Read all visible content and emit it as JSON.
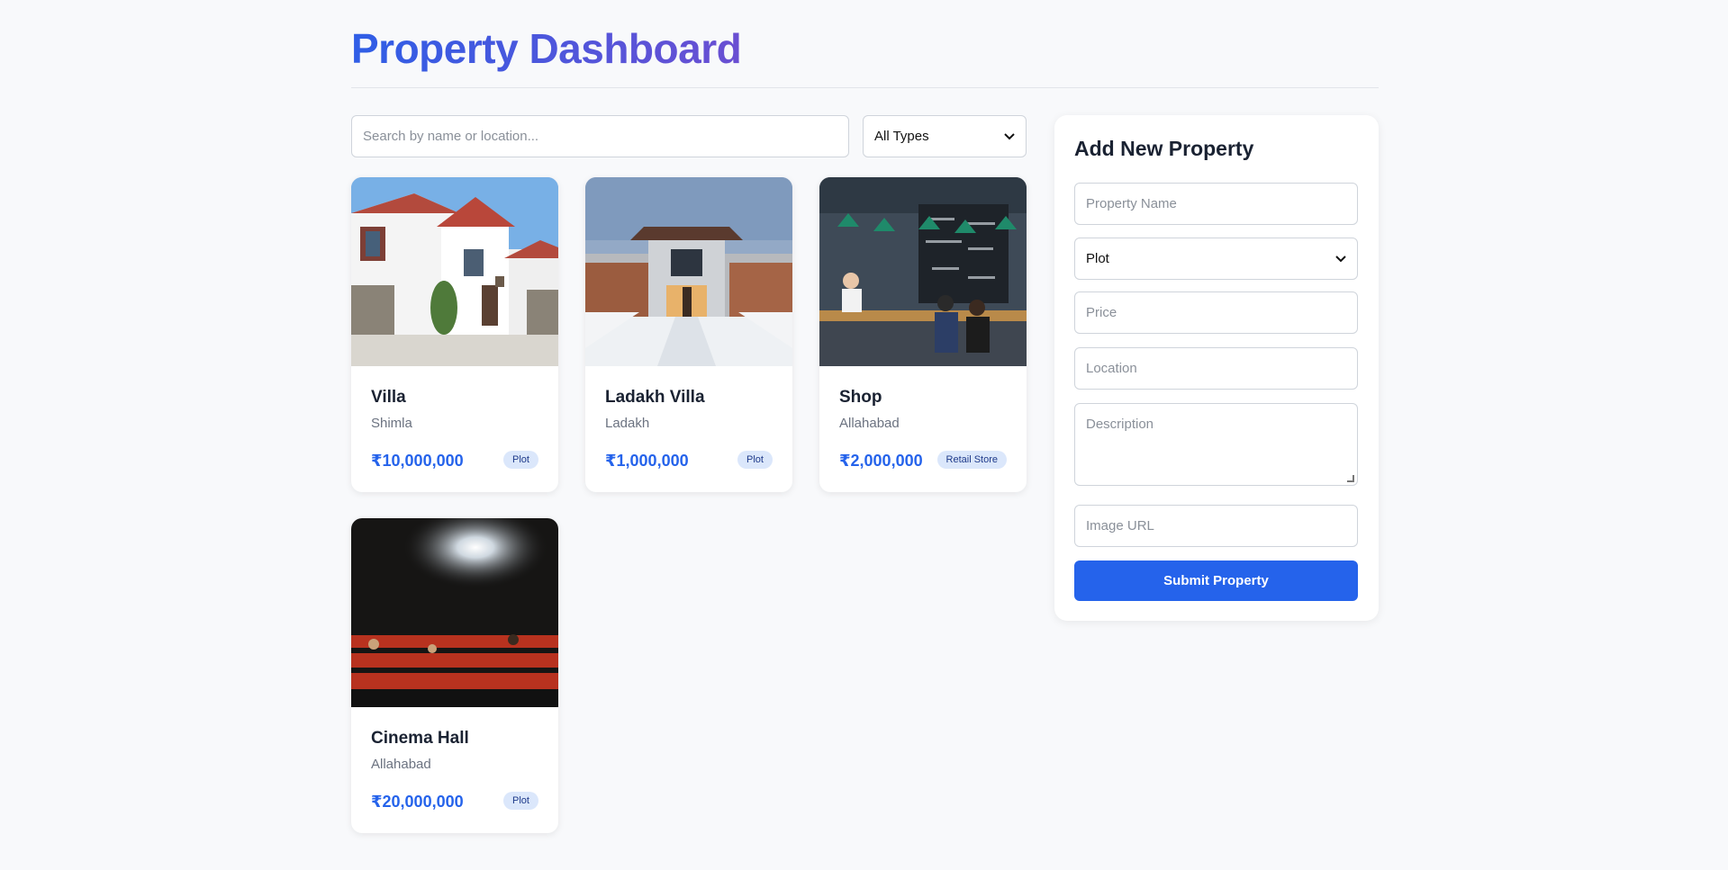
{
  "header": {
    "title": "Property Dashboard"
  },
  "filters": {
    "search_placeholder": "Search by name or location...",
    "type_selected": "All Types",
    "chevron_icon": "chevron-down-icon"
  },
  "properties": [
    {
      "name": "Villa",
      "location": "Shimla",
      "price": "₹10,000,000",
      "type": "Plot",
      "image": "white-villa-photo"
    },
    {
      "name": "Ladakh Villa",
      "location": "Ladakh",
      "price": "₹1,000,000",
      "type": "Plot",
      "image": "snow-house-photo"
    },
    {
      "name": "Shop",
      "location": "Allahabad",
      "price": "₹2,000,000",
      "type": "Retail Store",
      "image": "cafe-counter-photo"
    },
    {
      "name": "Cinema Hall",
      "location": "Allahabad",
      "price": "₹20,000,000",
      "type": "Plot",
      "image": "cinema-seats-photo"
    }
  ],
  "form": {
    "title": "Add New Property",
    "name_placeholder": "Property Name",
    "type_selected": "Plot",
    "price_placeholder": "Price",
    "location_placeholder": "Location",
    "description_placeholder": "Description",
    "image_placeholder": "Image URL",
    "submit_label": "Submit Property"
  },
  "colors": {
    "accent": "#2563eb",
    "title_gradient_start": "#2f5ee6",
    "title_gradient_end": "#6a4fd2",
    "badge_bg": "#dbe7fb",
    "page_bg": "#f8f9fb"
  }
}
